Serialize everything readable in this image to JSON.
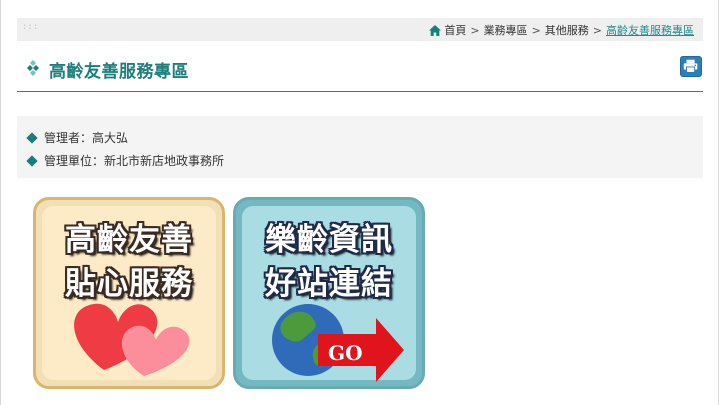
{
  "breadcrumb": {
    "items": [
      "首頁",
      "業務專區",
      "其他服務"
    ],
    "separator": ">",
    "current": "高齡友善服務專區"
  },
  "page": {
    "title": "高齡友善服務專區"
  },
  "info": {
    "manager": "管理者：高大弘",
    "unit": "管理單位：新北市新店地政事務所"
  },
  "tiles": [
    {
      "line1": "高齡友善",
      "line2": "貼心服務",
      "icon": "hearts-icon"
    },
    {
      "line1": "樂齡資訊",
      "line2": "好站連結",
      "icon": "globe-go-arrow-icon",
      "go_label": "GO"
    }
  ],
  "colors": {
    "accent": "#1d7e7e",
    "print_button": "#2c7fb8",
    "go_arrow": "#e0141c"
  }
}
